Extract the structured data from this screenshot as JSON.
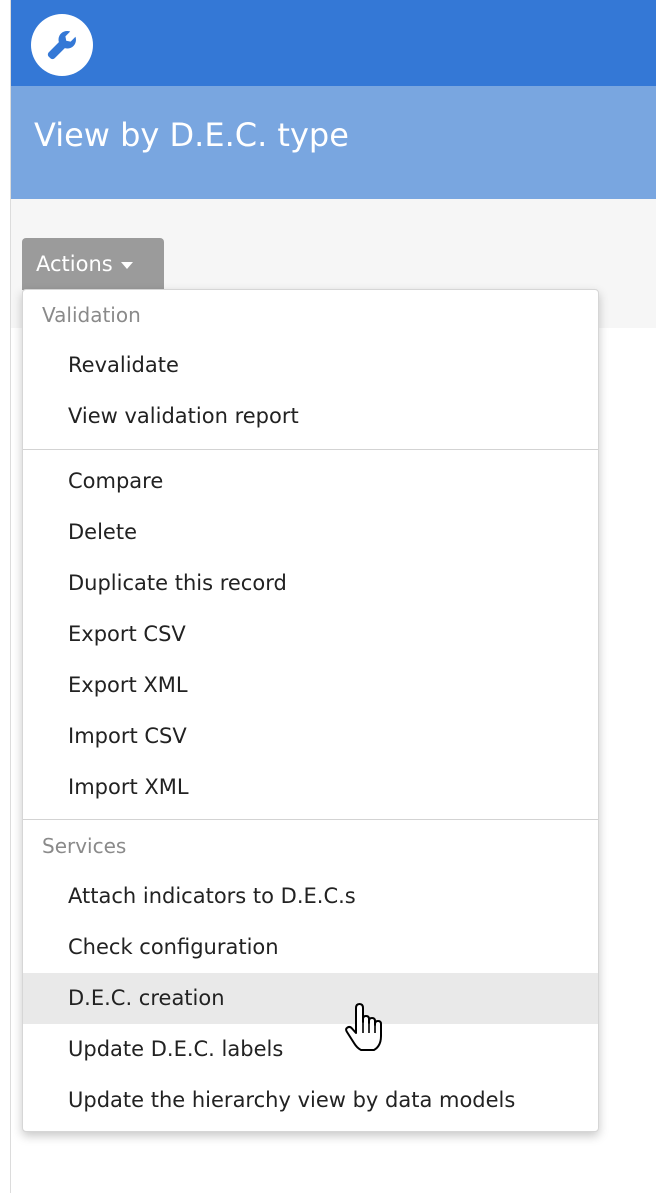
{
  "app": {
    "logo_icon": "wrench-icon",
    "header_color": "#3478d6",
    "title_band_color": "#79a6e0"
  },
  "page": {
    "title": "View by D.E.C. type"
  },
  "actions": {
    "label": "Actions",
    "caret_icon": "caret-down-icon"
  },
  "menu": {
    "group_validation": {
      "header": "Validation",
      "items": [
        "Revalidate",
        "View validation report"
      ]
    },
    "group_records": {
      "items": [
        "Compare",
        "Delete",
        "Duplicate this record",
        "Export CSV",
        "Export XML",
        "Import CSV",
        "Import XML"
      ]
    },
    "group_services": {
      "header": "Services",
      "items": [
        "Attach indicators to D.E.C.s",
        "Check configuration",
        "D.E.C. creation",
        "Update D.E.C. labels",
        "Update the hierarchy view by data models"
      ],
      "hovered_item": "D.E.C. creation"
    }
  },
  "pointer": {
    "icon": "hand-pointer-icon"
  }
}
